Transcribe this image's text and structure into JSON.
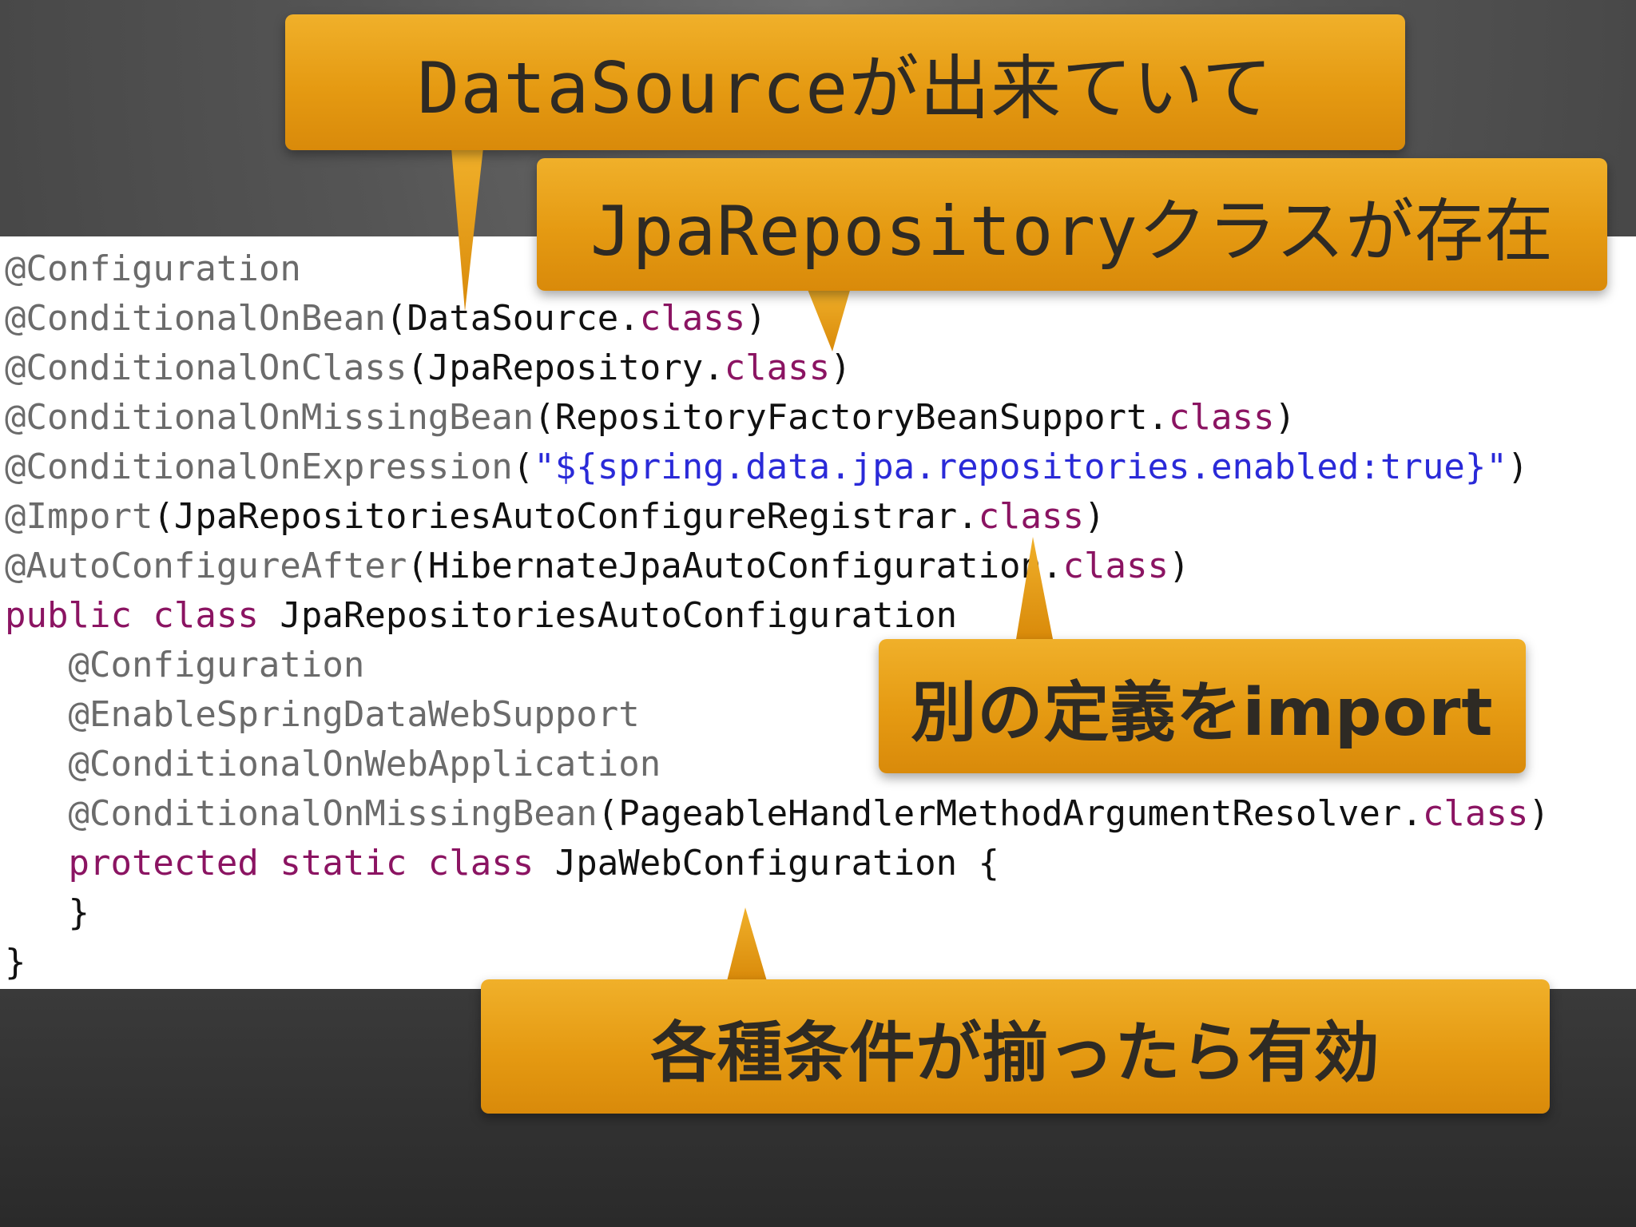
{
  "code": {
    "lines": [
      [
        {
          "t": "@Configuration",
          "c": "ann"
        }
      ],
      [
        {
          "t": "@ConditionalOnBean",
          "c": "ann"
        },
        {
          "t": "(DataSource.",
          "c": "txt"
        },
        {
          "t": "class",
          "c": "kw"
        },
        {
          "t": ")",
          "c": "txt"
        }
      ],
      [
        {
          "t": "@ConditionalOnClass",
          "c": "ann"
        },
        {
          "t": "(JpaRepository.",
          "c": "txt"
        },
        {
          "t": "class",
          "c": "kw"
        },
        {
          "t": ")",
          "c": "txt"
        }
      ],
      [
        {
          "t": "@ConditionalOnMissingBean",
          "c": "ann"
        },
        {
          "t": "(RepositoryFactoryBeanSupport.",
          "c": "txt"
        },
        {
          "t": "class",
          "c": "kw"
        },
        {
          "t": ")",
          "c": "txt"
        }
      ],
      [
        {
          "t": "@ConditionalOnExpression",
          "c": "ann"
        },
        {
          "t": "(",
          "c": "txt"
        },
        {
          "t": "\"${spring.data.jpa.repositories.enabled:true}\"",
          "c": "str"
        },
        {
          "t": ")",
          "c": "txt"
        }
      ],
      [
        {
          "t": "@Import",
          "c": "ann"
        },
        {
          "t": "(JpaRepositoriesAutoConfigureRegistrar.",
          "c": "txt"
        },
        {
          "t": "class",
          "c": "kw"
        },
        {
          "t": ")",
          "c": "txt"
        }
      ],
      [
        {
          "t": "@AutoConfigureAfter",
          "c": "ann"
        },
        {
          "t": "(HibernateJpaAutoConfiguration.",
          "c": "txt"
        },
        {
          "t": "class",
          "c": "kw"
        },
        {
          "t": ")",
          "c": "txt"
        }
      ],
      [
        {
          "t": "public class",
          "c": "kw"
        },
        {
          "t": " JpaRepositoriesAutoConfiguration",
          "c": "txt"
        }
      ],
      [
        {
          "t": "   @Configuration",
          "c": "ann"
        }
      ],
      [
        {
          "t": "   @EnableSpringDataWebSupport",
          "c": "ann"
        }
      ],
      [
        {
          "t": "   @ConditionalOnWebApplication",
          "c": "ann"
        }
      ],
      [
        {
          "t": "   @ConditionalOnMissingBean",
          "c": "ann"
        },
        {
          "t": "(PageableHandlerMethodArgumentResolver.",
          "c": "txt"
        },
        {
          "t": "class",
          "c": "kw"
        },
        {
          "t": ")",
          "c": "txt"
        }
      ],
      [
        {
          "t": "   protected static class",
          "c": "kw"
        },
        {
          "t": " JpaWebConfiguration {",
          "c": "txt"
        }
      ],
      [
        {
          "t": "   }",
          "c": "txt"
        }
      ],
      [
        {
          "t": "}",
          "c": "txt"
        }
      ]
    ]
  },
  "callouts": {
    "datasource": "DataSourceが出来ていて",
    "jparepository": "JpaRepositoryクラスが存在",
    "import": "別の定義をimport",
    "conditions": "各種条件が揃ったら有効"
  },
  "colors": {
    "annotation": "#6b6b6b",
    "keyword": "#8b1462",
    "string": "#2a2ad8",
    "text": "#111111",
    "callout": "#e59a12"
  }
}
